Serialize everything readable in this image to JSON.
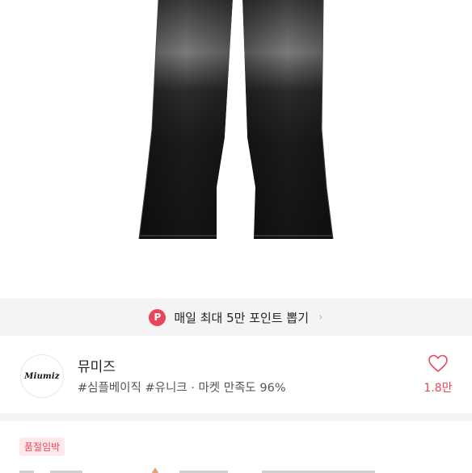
{
  "promo": {
    "badge": "P",
    "text": "매일 최대 5만 포인트 뽑기",
    "arrow": "›"
  },
  "shop": {
    "logo_text": "Miumiz",
    "name": "뮤미즈",
    "tags": "#심플베이직 #유니크 · 마켓 만족도 96%",
    "like_count": "1.8만"
  },
  "product": {
    "status_badge": "품절임박"
  },
  "colors": {
    "accent": "#e8465a",
    "promo_bg": "#f4f4f4",
    "badge_bg": "#fde8ea"
  },
  "icons": {
    "promo": "point-badge-icon",
    "arrow": "chevron-right-icon",
    "like": "heart-icon"
  }
}
